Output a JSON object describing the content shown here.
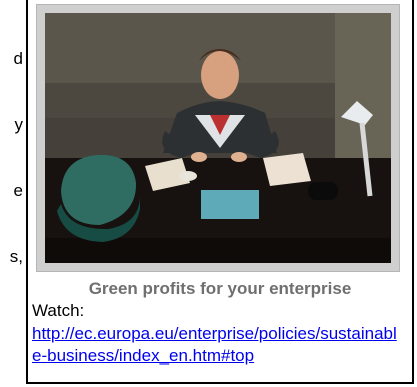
{
  "left_fragment": {
    "lines": [
      "d",
      "y",
      "e",
      "s,"
    ]
  },
  "card": {
    "image_alt": "Man seated at desk looking upward",
    "caption": "Green profits for your enterprise",
    "watch_label": "Watch:",
    "link_text": "http://ec.europa.eu/enterprise/policies/sustainable-business/index_en.htm#top"
  },
  "colors": {
    "caption": "#6f6f6f",
    "link": "#0000ee",
    "frame": "#cfcfcf"
  }
}
